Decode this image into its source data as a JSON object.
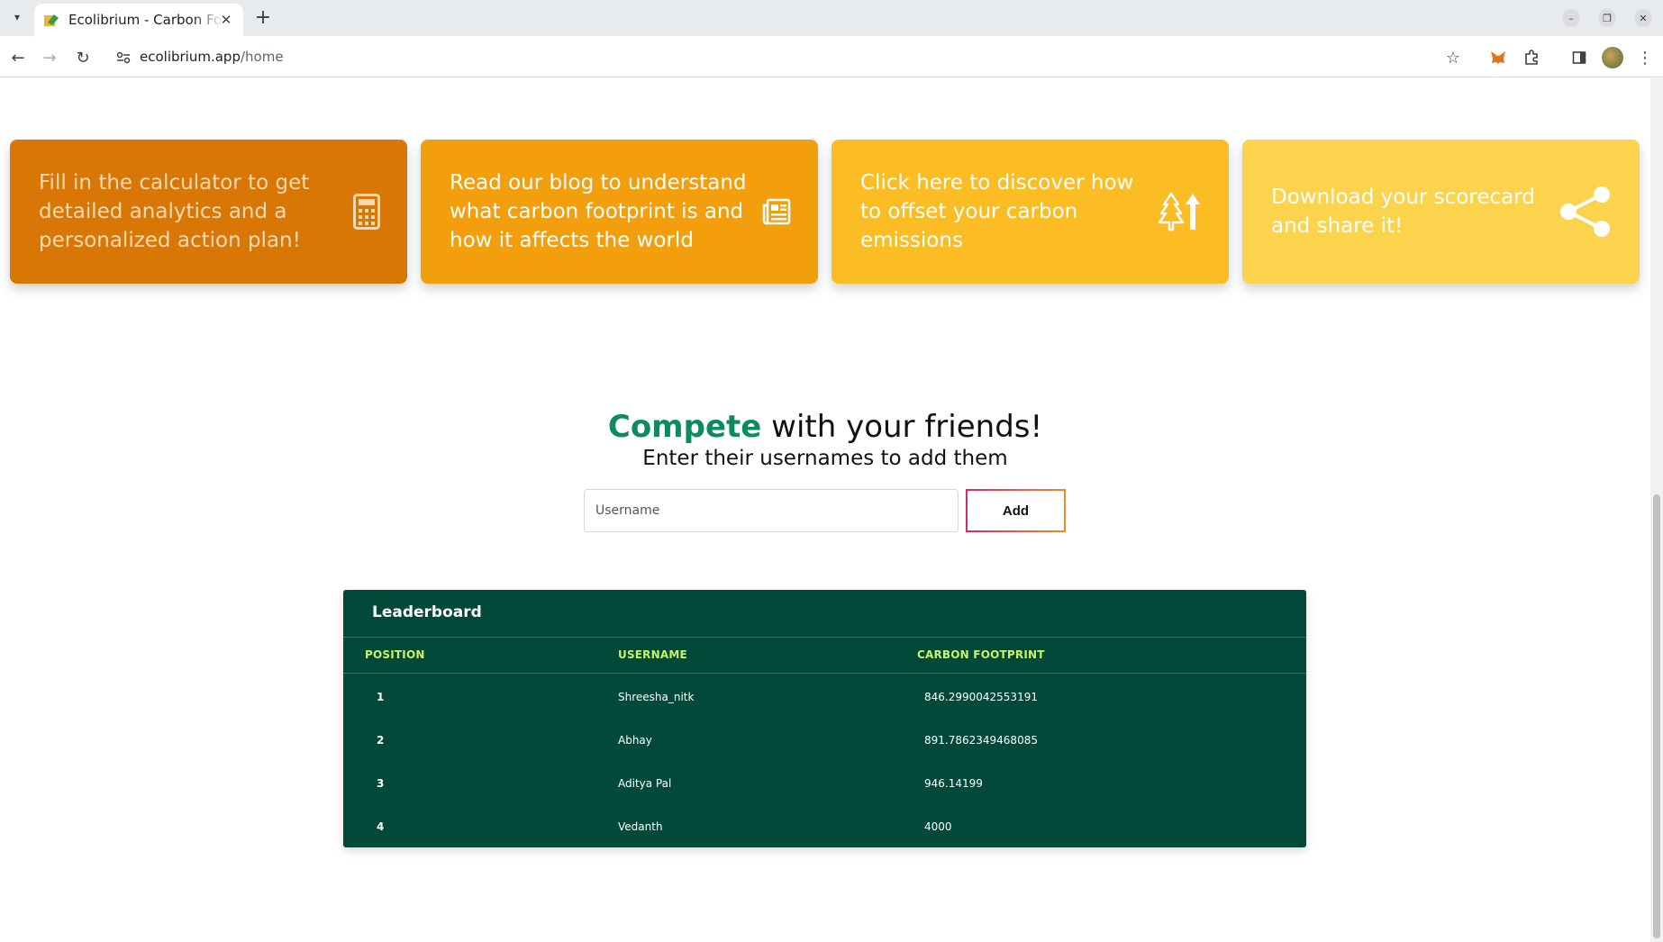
{
  "browser": {
    "tab_title": "Ecolibrium - Carbon Footprint",
    "url_host": "ecolibrium.app",
    "url_path": "/home"
  },
  "cards": [
    {
      "text": "Fill in the calculator to get detailed analytics and a personalized action plan!",
      "icon": "calculator-icon",
      "bg": "#d97706",
      "fg": "#f6d9b0"
    },
    {
      "text": "Read our blog to understand what carbon footprint is and how it affects the world",
      "icon": "newspaper-icon",
      "bg": "#f29e0d",
      "fg": "#ffffff"
    },
    {
      "text": "Click here to discover how to offset your carbon emissions",
      "icon": "trees-arrow-icon",
      "bg": "#fbbd23",
      "fg": "#ffffff"
    },
    {
      "text": "Download your scorecard and share it!",
      "icon": "share-icon",
      "bg": "#fcd34d",
      "fg": "#ffffff"
    }
  ],
  "compete": {
    "accent": "Compete",
    "rest": " with your friends!",
    "subtitle": "Enter their usernames to add them",
    "input_placeholder": "Username",
    "add_label": "Add"
  },
  "leaderboard": {
    "title": "Leaderboard",
    "columns": [
      "POSITION",
      "USERNAME",
      "CARBON FOOTPRINT"
    ],
    "rows": [
      {
        "position": "1",
        "username": "Shreesha_nitk",
        "footprint": "846.2990042553191"
      },
      {
        "position": "2",
        "username": "Abhay",
        "footprint": "891.7862349468085"
      },
      {
        "position": "3",
        "username": "Aditya Pal",
        "footprint": "946.14199"
      },
      {
        "position": "4",
        "username": "Vedanth",
        "footprint": "4000"
      }
    ]
  },
  "colors": {
    "accent_green": "#0e8a5f",
    "leaderboard_bg": "#03493a",
    "leaderboard_header": "#c9f26b"
  }
}
